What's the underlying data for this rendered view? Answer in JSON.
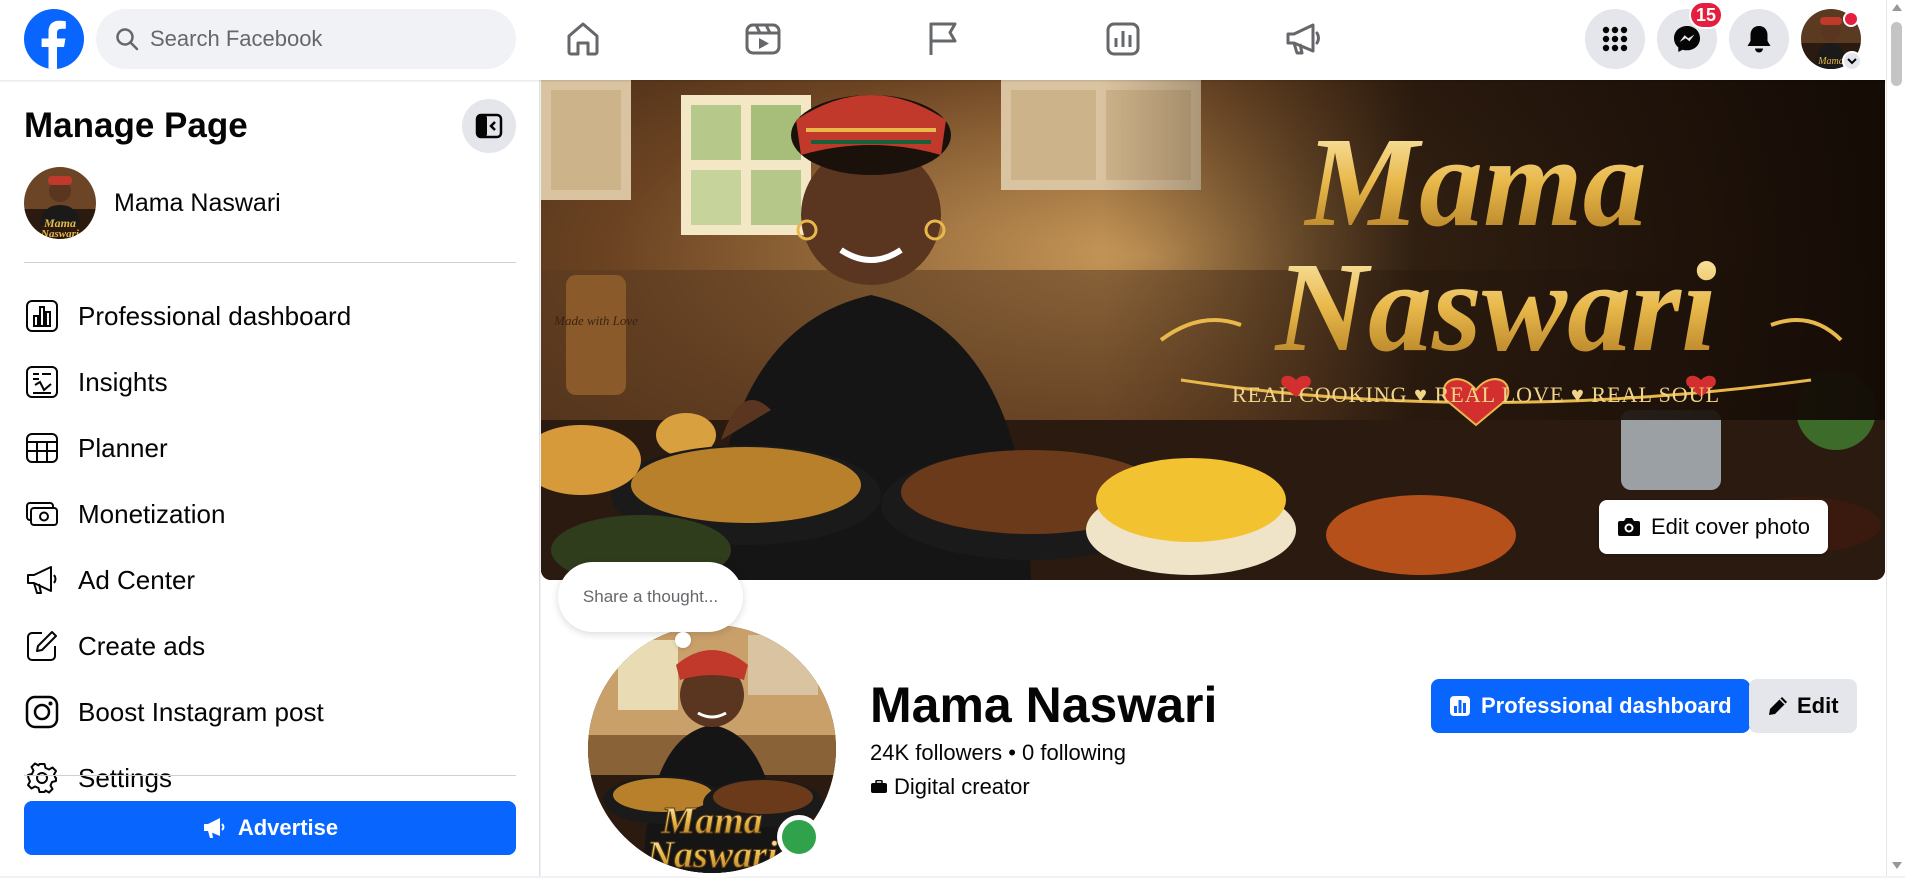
{
  "search": {
    "placeholder": "Search Facebook"
  },
  "header": {
    "nav": [
      "home-icon",
      "video-icon",
      "pages-flag-icon",
      "insights-icon",
      "megaphone-icon"
    ],
    "messenger_badge": "15"
  },
  "sidebar": {
    "title": "Manage Page",
    "page_name": "Mama Naswari",
    "items": [
      {
        "label": "Professional dashboard",
        "icon": "dashboard-icon"
      },
      {
        "label": "Insights",
        "icon": "insights-icon"
      },
      {
        "label": "Planner",
        "icon": "planner-icon"
      },
      {
        "label": "Monetization",
        "icon": "monetization-icon"
      },
      {
        "label": "Ad Center",
        "icon": "ad-center-icon"
      },
      {
        "label": "Create ads",
        "icon": "create-ads-icon"
      },
      {
        "label": "Boost Instagram post",
        "icon": "instagram-icon"
      },
      {
        "label": "Settings",
        "icon": "settings-icon"
      }
    ],
    "advertise_label": "Advertise"
  },
  "cover": {
    "title_line1": "Mama",
    "title_line2": "Naswari",
    "tagline": "REAL COOKING ♥ REAL LOVE ♥ REAL SOUL",
    "edit_label": "Edit cover photo",
    "board_text": "Made with Love"
  },
  "profile": {
    "thought_placeholder": "Share a thought...",
    "name": "Mama Naswari",
    "followers": "24K followers",
    "separator": " • ",
    "following": "0 following",
    "category": "Digital creator",
    "dashboard_button": "Professional dashboard",
    "edit_button": "Edit"
  },
  "colors": {
    "brand": "#0866ff",
    "badge": "#e41e3f",
    "online": "#31a24c",
    "gold": "#e8b84a"
  }
}
